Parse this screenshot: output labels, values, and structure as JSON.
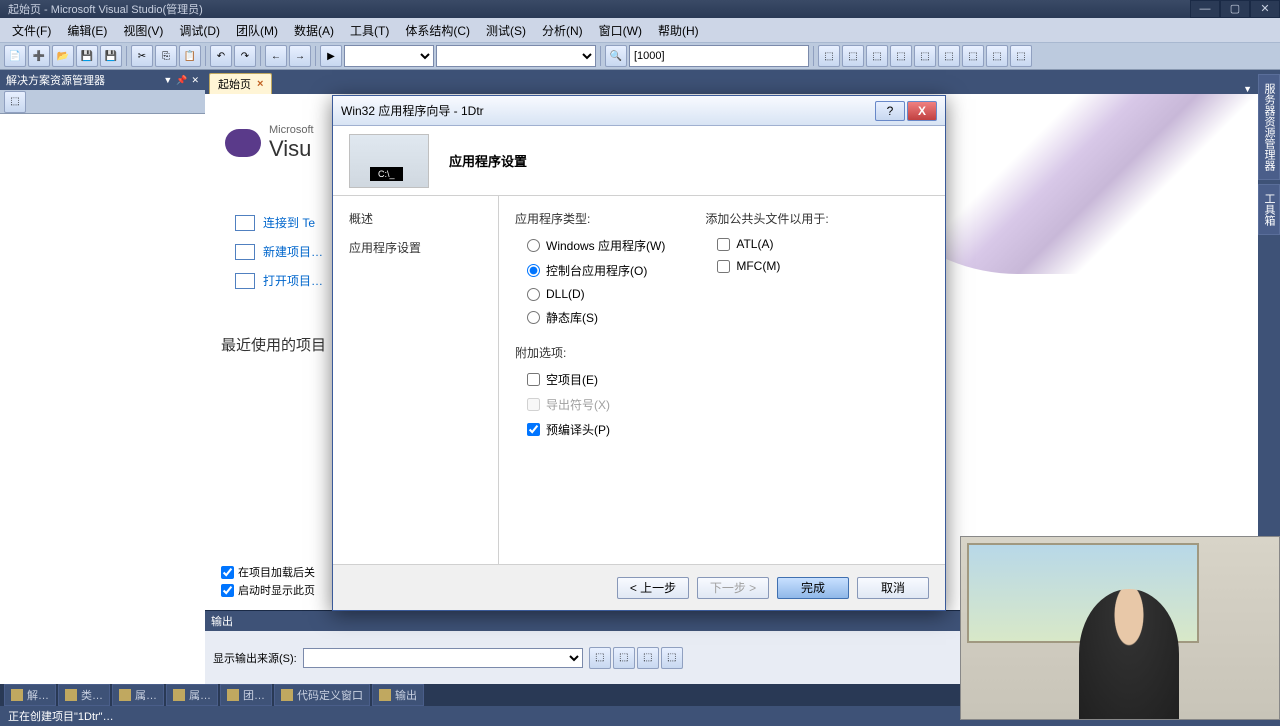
{
  "titlebar": {
    "text": "起始页 - Microsoft Visual Studio(管理员)"
  },
  "menu": [
    "文件(F)",
    "编辑(E)",
    "视图(V)",
    "调试(D)",
    "团队(M)",
    "数据(A)",
    "工具(T)",
    "体系结构(C)",
    "测试(S)",
    "分析(N)",
    "窗口(W)",
    "帮助(H)"
  ],
  "toolbar": {
    "combo_val": "[1000]"
  },
  "solution_explorer": {
    "title": "解决方案资源管理器"
  },
  "tab": {
    "label": "起始页"
  },
  "start_page": {
    "logo_small": "Microsoft",
    "logo_big": "Visu",
    "links": [
      "连接到 Te",
      "新建项目…",
      "打开项目…"
    ],
    "recent": "最近使用的项目",
    "check1": "在项目加载后关",
    "check2": "启动时显示此页"
  },
  "output": {
    "title": "输出",
    "label": "显示输出来源(S):"
  },
  "rail": [
    "服务器资源管理器",
    "工具箱"
  ],
  "bottom_tabs": [
    "解…",
    "类…",
    "属…",
    "属…",
    "团…",
    "代码定义窗口",
    "输出"
  ],
  "statusbar": "正在创建项目\"1Dtr\"…",
  "dialog": {
    "title": "Win32 应用程序向导 - 1Dtr",
    "banner": "应用程序设置",
    "sidebar": [
      "概述",
      "应用程序设置"
    ],
    "app_type_label": "应用程序类型:",
    "app_types": [
      {
        "label": "Windows 应用程序(W)",
        "checked": false
      },
      {
        "label": "控制台应用程序(O)",
        "checked": true
      },
      {
        "label": "DLL(D)",
        "checked": false
      },
      {
        "label": "静态库(S)",
        "checked": false
      }
    ],
    "addl_label": "附加选项:",
    "addl_opts": [
      {
        "label": "空项目(E)",
        "checked": false,
        "disabled": false
      },
      {
        "label": "导出符号(X)",
        "checked": false,
        "disabled": true
      },
      {
        "label": "预编译头(P)",
        "checked": true,
        "disabled": false
      }
    ],
    "headers_label": "添加公共头文件以用于:",
    "headers": [
      {
        "label": "ATL(A)",
        "checked": false
      },
      {
        "label": "MFC(M)",
        "checked": false
      }
    ],
    "btn_prev": "< 上一步",
    "btn_next": "下一步 >",
    "btn_finish": "完成",
    "btn_cancel": "取消"
  }
}
